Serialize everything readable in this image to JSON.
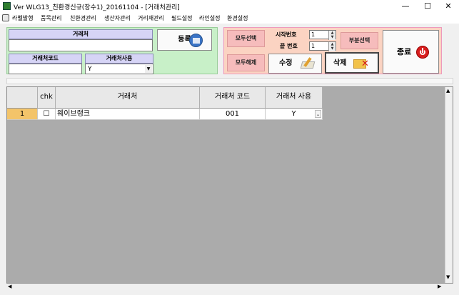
{
  "window": {
    "title": "Ver WLG13_친환경신규(장수1)_20161104 - [거래처관리]",
    "minimize_glyph": "—",
    "maximize_glyph": "☐",
    "close_glyph": "✕"
  },
  "menu": {
    "items": [
      "라벨발행",
      "품목관리",
      "친환경관리",
      "생산자관리",
      "거리재관리",
      "필드설정",
      "라인설정",
      "환경설정"
    ]
  },
  "filter": {
    "client_label": "거래처",
    "client_value": "",
    "client_code_label": "거래처코드",
    "client_code_value": "",
    "client_use_label": "거래처사용",
    "client_use_value": "Y",
    "register_button": "등록"
  },
  "actions": {
    "select_all": "모두선택",
    "deselect_all": "모두해제",
    "start_no_label": "시작번호",
    "start_no_value": "1",
    "end_no_label": "끝 번호",
    "end_no_value": "1",
    "partial_select": "부분선택",
    "edit_button": "수정",
    "delete_button": "삭제",
    "exit_button": "종료"
  },
  "grid": {
    "columns": [
      "chk",
      "거래처",
      "거래처 코드",
      "거래처 사용"
    ],
    "rows": [
      {
        "row_no": "1",
        "checked": "☐",
        "client": "웨이브랭크",
        "code": "001",
        "use": "Y"
      }
    ]
  },
  "colors": {
    "green_panel": "#c8f0c8",
    "pink_panel": "#fbd3c2",
    "label_purple": "#d6d4f6",
    "row_selected": "#f3c46a"
  }
}
